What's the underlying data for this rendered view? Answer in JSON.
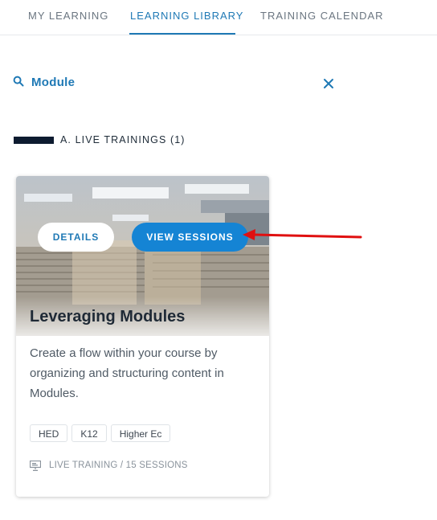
{
  "tabs": [
    {
      "label": "MY LEARNING",
      "active": false
    },
    {
      "label": "LEARNING LIBRARY",
      "active": true
    },
    {
      "label": "TRAINING CALENDAR",
      "active": false
    }
  ],
  "search": {
    "value": "Module",
    "icon": "search-icon",
    "clear_icon": "close-icon"
  },
  "section": {
    "title": "A. LIVE TRAININGS (1)"
  },
  "card": {
    "title": "Leveraging Modules",
    "details_label": "DETAILS",
    "view_sessions_label": "VIEW SESSIONS",
    "description": "Create a flow within your course by organizing and structuring content in Modules.",
    "tags": [
      "HED",
      "K12",
      "Higher Ec"
    ],
    "meta": "LIVE TRAINING / 15 SESSIONS",
    "meta_icon": "presentation-icon"
  },
  "colors": {
    "accent": "#1f79b5",
    "primary_button": "#1584d4",
    "annotation_arrow": "#e01010"
  }
}
